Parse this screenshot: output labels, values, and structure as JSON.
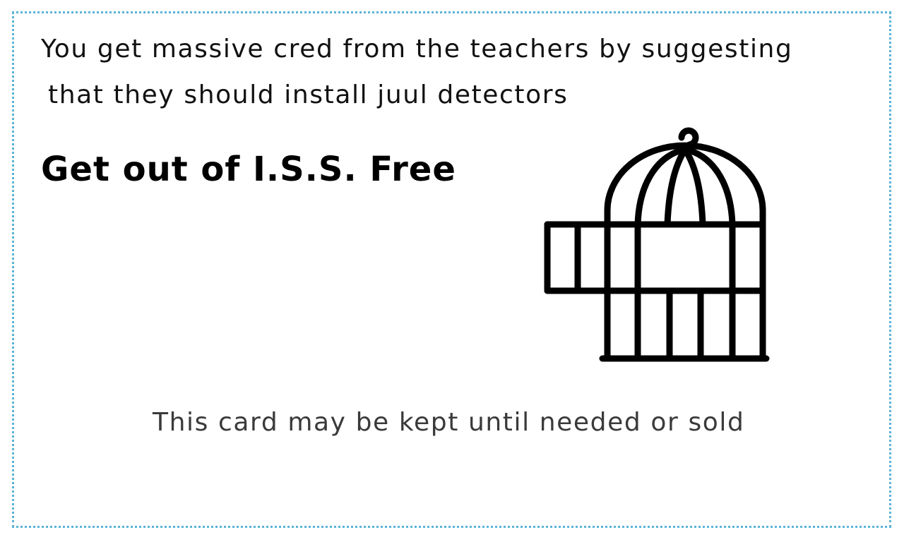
{
  "card": {
    "intro_line_1": "You get massive cred from the teachers by suggesting",
    "intro_line_2": "that they should install juul detectors",
    "title": "Get out of I.S.S. Free",
    "footer": "This card may be kept until needed or sold",
    "border_color": "#5ab4d6",
    "icon": "open-birdcage-icon"
  }
}
